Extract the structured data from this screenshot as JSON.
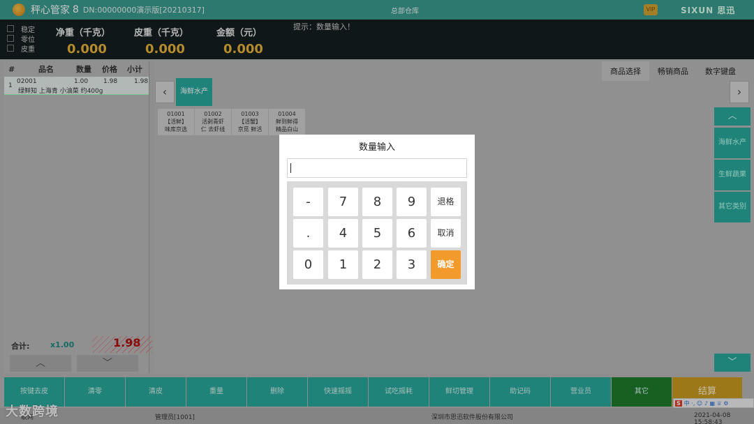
{
  "titlebar": {
    "app_name": "秤心管家",
    "app_num": "8",
    "version": "DN:00000000演示版[20210317]",
    "store": "总部仓库",
    "vip": "VIP",
    "brand": "SIXUN 思迅"
  },
  "scale": {
    "flags": [
      "稳定",
      "零位",
      "皮重"
    ],
    "net_label": "净重（千克）",
    "net_value": "0.000",
    "tare_label": "皮重（千克）",
    "tare_value": "0.000",
    "amount_label": "金额（元）",
    "amount_value": "0.000",
    "hint": "提示：数量输入！"
  },
  "order": {
    "headers": [
      "#",
      "品名",
      "数量",
      "价格",
      "小计"
    ],
    "rows": [
      {
        "index": "1",
        "code": "02001",
        "qty": "1.00",
        "price": "1.98",
        "subtotal": "1.98",
        "name": "绿鲜知 上海青 小油菜 约400g"
      }
    ],
    "total_label": "合计:",
    "total_qty": "x1.00",
    "total_amount": "1.98"
  },
  "tabs": [
    "商品选择",
    "畅销商品",
    "数字键盘"
  ],
  "active_tab": "商品选择",
  "category": "海鲜水产",
  "products": [
    {
      "code": "01001",
      "name1": "【活鲜】",
      "name2": "味库京选"
    },
    {
      "code": "01002",
      "name1": "活剥青虾",
      "name2": "仁 去虾线"
    },
    {
      "code": "01003",
      "name1": "【活蟹】",
      "name2": "京觅 鲜活"
    },
    {
      "code": "01004",
      "name1": "鲜到鲜得",
      "name2": "精品白山"
    }
  ],
  "side_categories": [
    "海鲜水产",
    "生鲜蔬果",
    "其它类别"
  ],
  "function_buttons": [
    "按键去皮",
    "清零",
    "清皮",
    "重量",
    "删除",
    "快速摇摇",
    "试吃摇耗",
    "鲜切管理",
    "助记码",
    "营业员",
    "其它",
    "结算"
  ],
  "status": {
    "left": "联网",
    "operator": "管理员[1001]",
    "company": "深圳市思迅软件股份有限公司",
    "datetime": "2021-04-08 15:58:43"
  },
  "watermark": "大数跨境",
  "ime": {
    "logo": "S",
    "text": "中 ·, ☺ ♪ ▦ ♕ ⚙"
  },
  "dialog": {
    "title": "数量输入",
    "input_value": "",
    "keys": {
      "minus": "-",
      "dot": ".",
      "k0": "0",
      "k1": "1",
      "k2": "2",
      "k3": "3",
      "k4": "4",
      "k5": "5",
      "k6": "6",
      "k7": "7",
      "k8": "8",
      "k9": "9",
      "backspace": "退格",
      "cancel": "取消",
      "confirm": "确定"
    }
  },
  "colors": {
    "teal": "#2aa89c",
    "orange": "#f39a2d",
    "gold": "#c99a1f",
    "dark_green": "#1f7a2c"
  }
}
